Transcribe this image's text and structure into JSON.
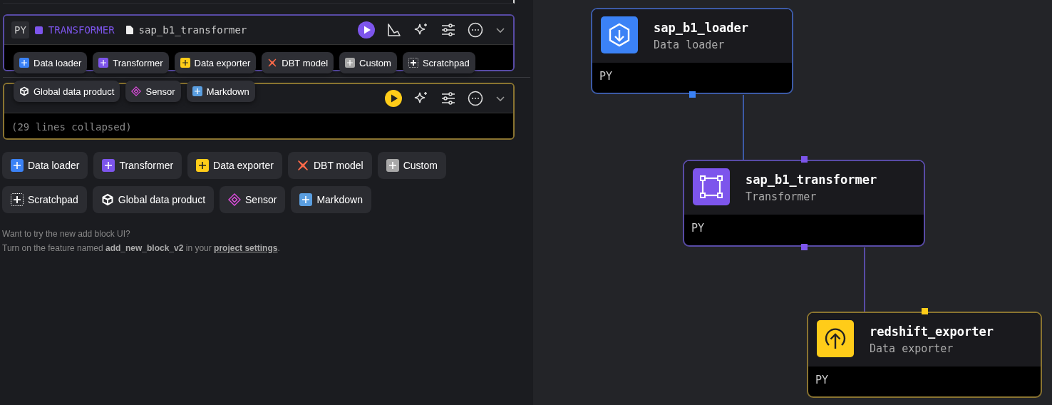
{
  "blocks": [
    {
      "language": "PY",
      "type_label": "TRANSFORMER",
      "file": "sap_b1_transformer",
      "color": "#7d55ec",
      "chart": true
    },
    {
      "color": "#ffcc19",
      "chart": false,
      "body": "(29 lines collapsed)"
    }
  ],
  "add_buttons": [
    {
      "label": "Data loader",
      "kind": "plus",
      "color": "#3b82f6"
    },
    {
      "label": "Transformer",
      "kind": "plus",
      "color": "#7d55ec"
    },
    {
      "label": "Data exporter",
      "kind": "plus",
      "color": "#ffcc19"
    },
    {
      "label": "DBT model",
      "kind": "dbt",
      "color": "#fc6949"
    },
    {
      "label": "Custom",
      "kind": "plus",
      "color": "#a8a8a8"
    },
    {
      "label": "Scratchpad",
      "kind": "scratch",
      "color": "#ffffff"
    },
    {
      "label": "Global data product",
      "kind": "cube",
      "color": "#ffffff"
    },
    {
      "label": "Sensor",
      "kind": "sensor",
      "color": "#e04ee0"
    },
    {
      "label": "Markdown",
      "kind": "plus",
      "color": "#5a9ee0"
    }
  ],
  "popup_menu": [
    {
      "label": "Data loader",
      "kind": "plus",
      "color": "#3b82f6"
    },
    {
      "label": "Transformer",
      "kind": "plus",
      "color": "#7d55ec"
    },
    {
      "label": "Data exporter",
      "kind": "plus",
      "color": "#ffcc19"
    },
    {
      "label": "DBT model",
      "kind": "dbt",
      "color": "#fc6949"
    },
    {
      "label": "Custom",
      "kind": "plus",
      "color": "#a8a8a8"
    },
    {
      "label": "Scratchpad",
      "kind": "scratch",
      "color": "#ffffff"
    },
    {
      "label": "Global data product",
      "kind": "cube",
      "color": "#ffffff"
    },
    {
      "label": "Sensor",
      "kind": "sensor",
      "color": "#e04ee0"
    },
    {
      "label": "Markdown",
      "kind": "plus",
      "color": "#5a9ee0"
    }
  ],
  "hint": {
    "question": "Want to try the new add block UI?",
    "text": "Turn on the feature named **add_new_block_v2** in your",
    "link": "project settings",
    "end": "."
  },
  "nodes": [
    {
      "name": "sap_b1_loader",
      "type": "Data loader",
      "kind": "loader",
      "language": "PY",
      "color": "#3b82f6"
    },
    {
      "name": "sap_b1_transformer",
      "type": "Transformer",
      "kind": "transformer",
      "language": "PY",
      "color": "#7d55ec"
    },
    {
      "name": "redshift_exporter",
      "type": "Data exporter",
      "kind": "exporter",
      "language": "PY",
      "color": "#ffcc19"
    }
  ]
}
